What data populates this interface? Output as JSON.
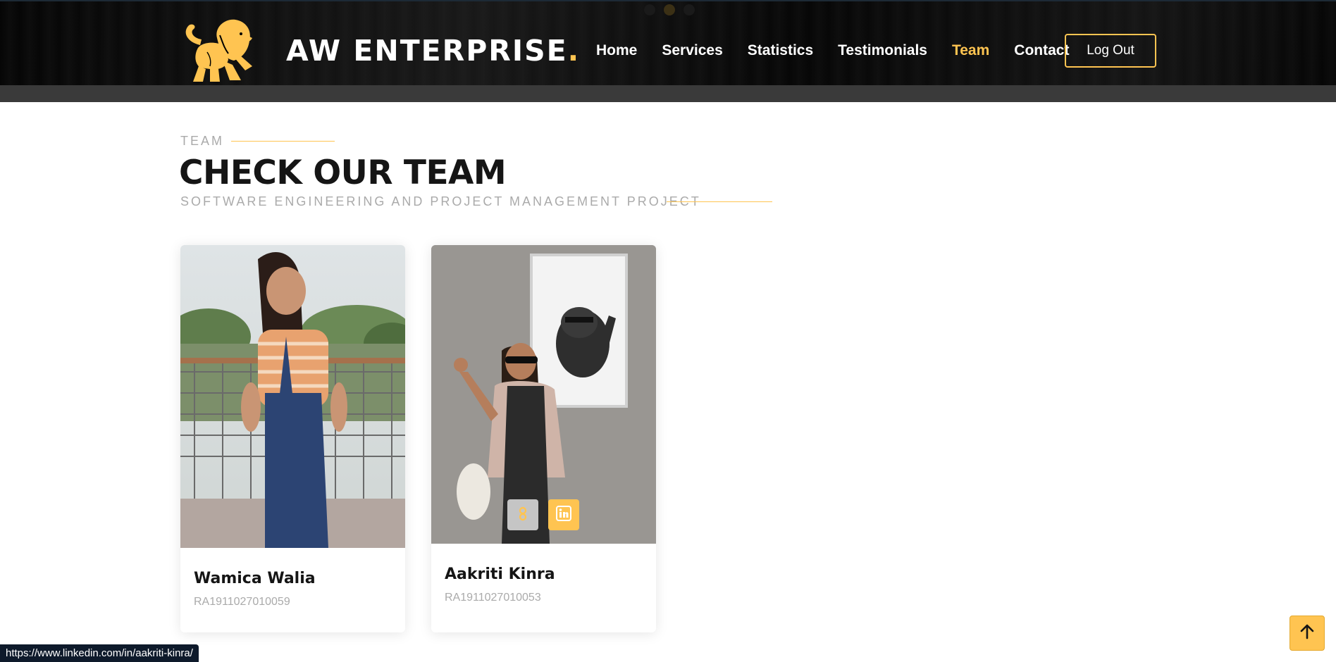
{
  "colors": {
    "accent": "#ffc451",
    "header_bg": "#000000",
    "title_text": "#151515",
    "muted_text": "#aaaaaa"
  },
  "header": {
    "logo_icon": "lion-icon",
    "brand_name": "AW ENTERPRISE",
    "brand_dot": ".",
    "nav": [
      {
        "label": "Home",
        "active": false
      },
      {
        "label": "Services",
        "active": false
      },
      {
        "label": "Statistics",
        "active": false
      },
      {
        "label": "Testimonials",
        "active": false
      },
      {
        "label": "Team",
        "active": true
      },
      {
        "label": "Contact",
        "active": false
      }
    ],
    "logout_label": "Log Out"
  },
  "section": {
    "label": "TEAM",
    "title": "CHECK OUR TEAM",
    "subtitle": "SOFTWARE ENGINEERING AND PROJECT MANAGEMENT PROJECT"
  },
  "team": [
    {
      "name": "Wamica Walia",
      "id": "RA1911027010059",
      "photo_icon": "member-photo"
    },
    {
      "name": "Aakriti Kinra",
      "id": "RA1911027010053",
      "photo_icon": "member-photo",
      "social": [
        "github-icon",
        "linkedin-icon"
      ]
    }
  ],
  "status_bar": {
    "url": "https://www.linkedin.com/in/aakriti-kinra/"
  },
  "back_to_top_icon": "arrow-up-icon"
}
